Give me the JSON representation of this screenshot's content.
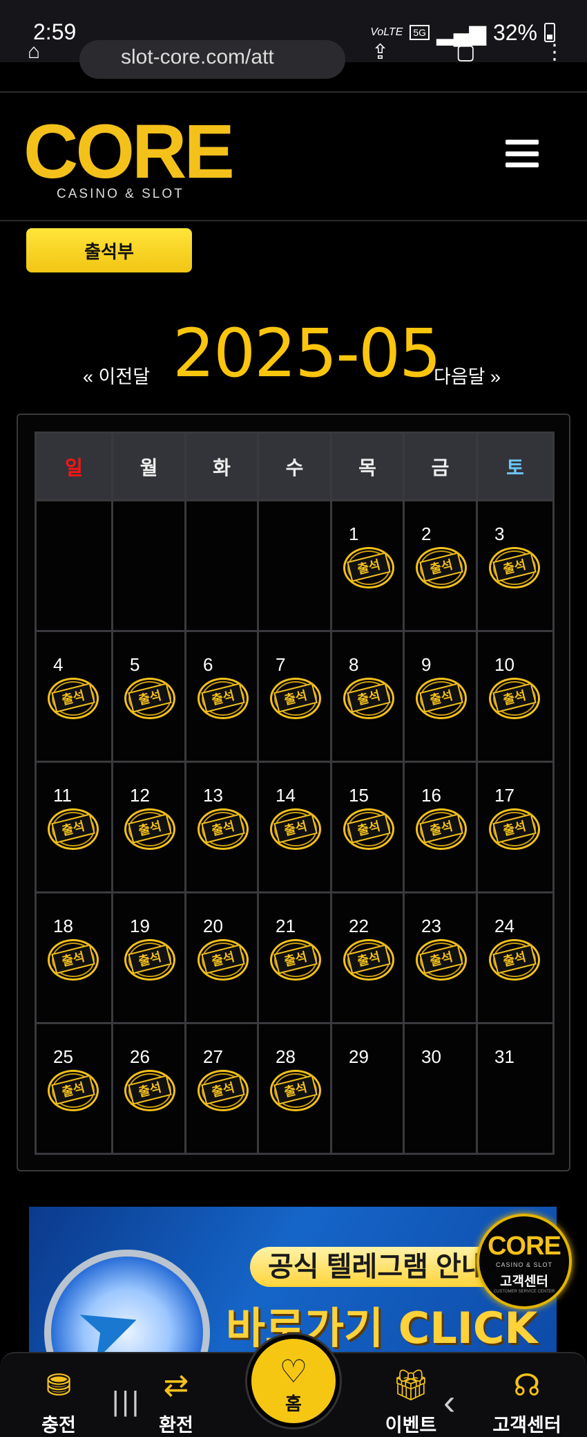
{
  "status_bar": {
    "time": "2:59",
    "network": "VoLTE",
    "network_type": "5G",
    "battery": "32%"
  },
  "browser": {
    "url_fragment": "slot-core.com/att"
  },
  "header": {
    "logo_text": "CORE",
    "logo_sub": "CASINO & SLOT"
  },
  "page": {
    "title_button": "출석부"
  },
  "month_nav": {
    "prev_label": "« 이전달",
    "month": "2025-05",
    "next_label": "다음달 »"
  },
  "calendar": {
    "weekdays": [
      "일",
      "월",
      "화",
      "수",
      "목",
      "금",
      "토"
    ],
    "stamp_label": "출석",
    "weeks": [
      [
        {
          "day": "",
          "stamp": false
        },
        {
          "day": "",
          "stamp": false
        },
        {
          "day": "",
          "stamp": false
        },
        {
          "day": "",
          "stamp": false
        },
        {
          "day": "1",
          "stamp": true
        },
        {
          "day": "2",
          "stamp": true
        },
        {
          "day": "3",
          "stamp": true
        }
      ],
      [
        {
          "day": "4",
          "stamp": true
        },
        {
          "day": "5",
          "stamp": true
        },
        {
          "day": "6",
          "stamp": true
        },
        {
          "day": "7",
          "stamp": true
        },
        {
          "day": "8",
          "stamp": true
        },
        {
          "day": "9",
          "stamp": true
        },
        {
          "day": "10",
          "stamp": true
        }
      ],
      [
        {
          "day": "11",
          "stamp": true
        },
        {
          "day": "12",
          "stamp": true
        },
        {
          "day": "13",
          "stamp": true
        },
        {
          "day": "14",
          "stamp": true
        },
        {
          "day": "15",
          "stamp": true
        },
        {
          "day": "16",
          "stamp": true
        },
        {
          "day": "17",
          "stamp": true
        }
      ],
      [
        {
          "day": "18",
          "stamp": true
        },
        {
          "day": "19",
          "stamp": true
        },
        {
          "day": "20",
          "stamp": true
        },
        {
          "day": "21",
          "stamp": true
        },
        {
          "day": "22",
          "stamp": true
        },
        {
          "day": "23",
          "stamp": true
        },
        {
          "day": "24",
          "stamp": true
        }
      ],
      [
        {
          "day": "25",
          "stamp": true
        },
        {
          "day": "26",
          "stamp": true
        },
        {
          "day": "27",
          "stamp": true
        },
        {
          "day": "28",
          "stamp": true
        },
        {
          "day": "29",
          "stamp": false
        },
        {
          "day": "30",
          "stamp": false
        },
        {
          "day": "31",
          "stamp": false
        }
      ]
    ]
  },
  "banner": {
    "line1": "공식 텔레그램 안내",
    "line2": "바로가기 CLICK"
  },
  "support_badge": {
    "logo": "CORE",
    "sub": "CASINO & SLOT",
    "title": "고객센터",
    "tiny": "CUSTOMER SERVICE CENTER"
  },
  "bottom_nav": {
    "charge": "충전",
    "exchange": "환전",
    "home": "홈",
    "event": "이벤트",
    "support": "고객센터"
  },
  "colors": {
    "accent": "#f4c11b",
    "sunday": "#ff1414",
    "saturday": "#6cc7ff"
  }
}
